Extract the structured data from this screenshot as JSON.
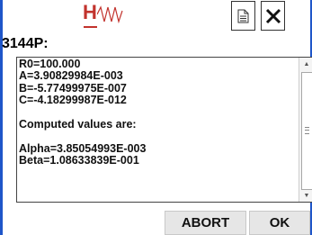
{
  "header": {
    "logo_text": "H",
    "title": "3144P:",
    "doc_icon": "document-icon",
    "close_icon": "close-icon"
  },
  "textbox": {
    "lines": [
      "R0=100.000",
      "A=3.90829984E-003",
      "B=-5.77499975E-007",
      "C=-4.18299987E-012",
      "",
      "Computed values are:",
      "",
      "Alpha=3.85054993E-003",
      "Beta=1.08633839E-001"
    ]
  },
  "buttons": {
    "abort": "ABORT",
    "ok": "OK"
  },
  "colors": {
    "frame": "#1f56c9",
    "logo": "#c2332d"
  }
}
